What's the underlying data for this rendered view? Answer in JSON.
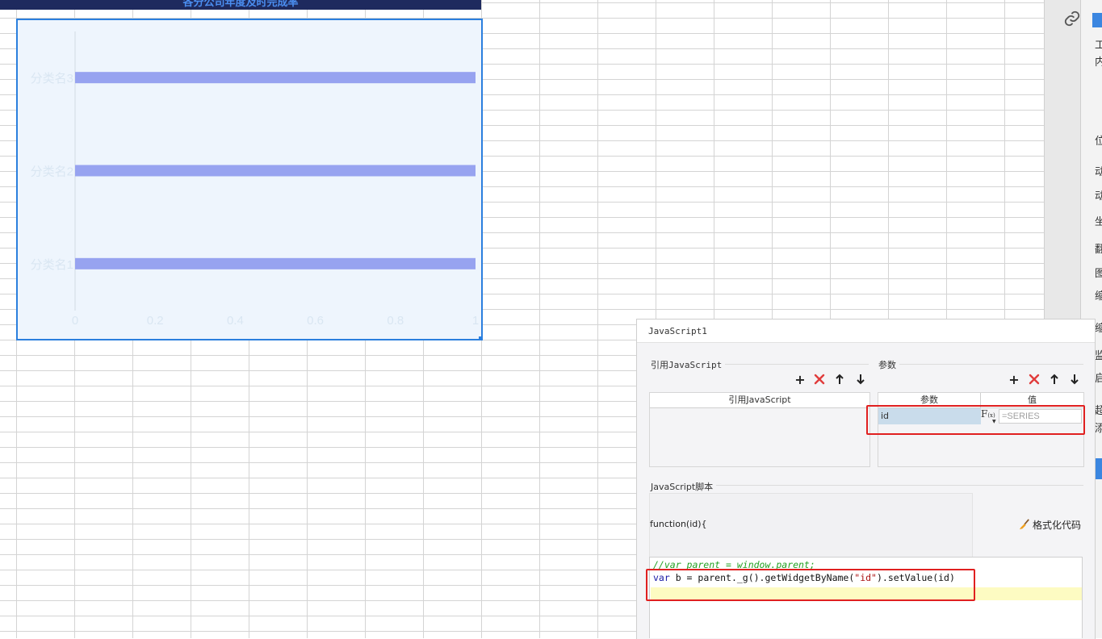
{
  "sheet": {
    "title_bar_text": "各分公司年度及时完成率"
  },
  "chart_data": {
    "type": "bar",
    "orientation": "horizontal",
    "categories": [
      "分类名3",
      "分类名2",
      "分类名1"
    ],
    "values": [
      1,
      1,
      1
    ],
    "xlim": [
      0,
      1
    ],
    "x_ticks": [
      "0",
      "0.2",
      "0.4",
      "0.6",
      "0.8",
      "1"
    ],
    "bar_color": "#97a3f0",
    "background_color": "#eef5fd",
    "title": "",
    "xlabel": "",
    "ylabel": ""
  },
  "right_panel": {
    "chars": [
      "工",
      "内",
      "位",
      "动",
      "动",
      "坐",
      "翻",
      "图",
      "缩",
      "缩",
      "监",
      "启",
      "超",
      "添"
    ]
  },
  "dialog": {
    "title": "JavaScript1",
    "ref_js": {
      "section_label": "引用JavaScript",
      "column_header": "引用JavaScript",
      "toolbar": {
        "add": "+",
        "delete": "✕",
        "up": "🡑",
        "down": "🡓"
      }
    },
    "params": {
      "section_label": "参数",
      "col_param": "参数",
      "col_value": "值",
      "rows": [
        {
          "name": "id",
          "value": "=SERIES"
        }
      ],
      "fx_label": "F",
      "fx_sub": "(x)",
      "toolbar": {
        "add": "+",
        "delete": "✕",
        "up": "🡑",
        "down": "🡓"
      }
    },
    "script": {
      "section_label": "JavaScript脚本",
      "function_signature": "function(id){",
      "format_button": "格式化代码",
      "code_comment": "//var parent = window.parent;",
      "code_kw": "var",
      "code_pre": " b = parent._g().getWidgetByName(",
      "code_str": "\"id\"",
      "code_post": ").setValue(id)"
    }
  },
  "colors": {
    "highlight_frame": "#e02020",
    "chart_border": "#2b7fde",
    "title_bar": "#1e2a5e"
  }
}
